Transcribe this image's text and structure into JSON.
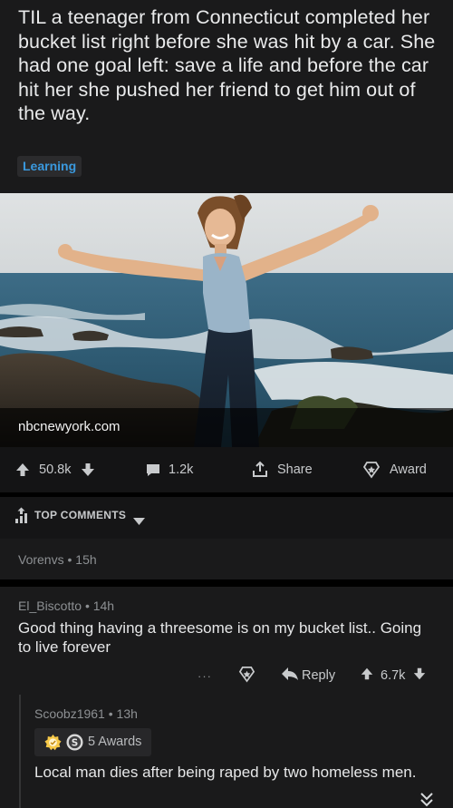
{
  "post": {
    "title": "TIL a teenager from Connecticut completed her bucket list right before she was hit by a car. She had one goal left: save a life and before the car hit her she pushed her friend to get him out of the way.",
    "flair": "Learning",
    "link_domain": "nbcnewyork.com",
    "upvotes": "50.8k",
    "comments": "1.2k",
    "share_label": "Share",
    "award_label": "Award"
  },
  "sort": {
    "label": "TOP COMMENTS"
  },
  "comments": [
    {
      "author": "Vorenvs",
      "age": "15h",
      "collapsed": true
    },
    {
      "author": "El_Biscotto",
      "age": "14h",
      "body": "Good thing having a threesome is on my bucket list.. Going to live forever",
      "more": "···",
      "reply_label": "Reply",
      "score": "6.7k"
    }
  ],
  "reply": {
    "author": "Scoobz1961",
    "age": "13h",
    "awards_label": "5 Awards",
    "body": "Local man dies after being raped by two homeless men."
  },
  "colors": {
    "flair": "#3a99de",
    "background": "#1a1a1b",
    "page": "#000000"
  },
  "icons": [
    "upvote-icon",
    "downvote-icon",
    "comment-icon",
    "share-icon",
    "award-icon",
    "sort-icon",
    "dropdown-icon",
    "star-icon",
    "reply-icon",
    "silver-award-icon",
    "helpful-award-icon",
    "collapse-chevron-icon"
  ]
}
